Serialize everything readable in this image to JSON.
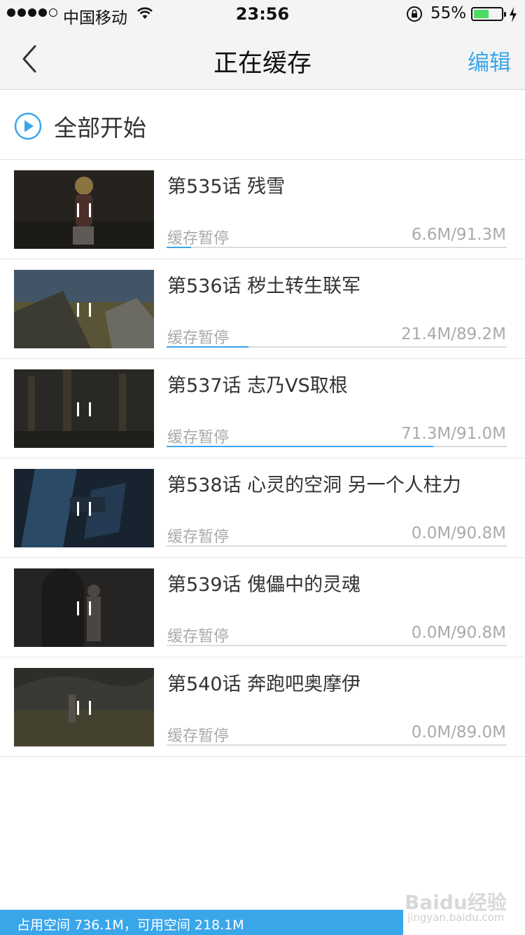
{
  "status_bar": {
    "carrier": "中国移动",
    "time": "23:56",
    "battery_percent": "55%",
    "battery_level": 0.55
  },
  "nav": {
    "title": "正在缓存",
    "edit_label": "编辑"
  },
  "start_all": {
    "label": "全部开始"
  },
  "colors": {
    "accent": "#3aa6ea",
    "battery_green": "#4cd964"
  },
  "episodes": [
    {
      "title": "第535话 残雪",
      "status": "缓存暂停",
      "size": "6.6M/91.3M",
      "progress": 0.072
    },
    {
      "title": "第536话 秽土转生联军",
      "status": "缓存暂停",
      "size": "21.4M/89.2M",
      "progress": 0.24
    },
    {
      "title": "第537话 志乃VS取根",
      "status": "缓存暂停",
      "size": "71.3M/91.0M",
      "progress": 0.783
    },
    {
      "title": "第538话 心灵的空洞 另一个人柱力",
      "status": "缓存暂停",
      "size": "0.0M/90.8M",
      "progress": 0
    },
    {
      "title": "第539话 傀儡中的灵魂",
      "status": "缓存暂停",
      "size": "0.0M/90.8M",
      "progress": 0
    },
    {
      "title": "第540话 奔跑吧奥摩伊",
      "status": "缓存暂停",
      "size": "0.0M/89.0M",
      "progress": 0
    }
  ],
  "footer": {
    "storage_text": "占用空间 736.1M，可用空间 218.1M"
  },
  "watermark": {
    "logo": "Baidu经验",
    "url": "jingyan.baidu.com"
  }
}
